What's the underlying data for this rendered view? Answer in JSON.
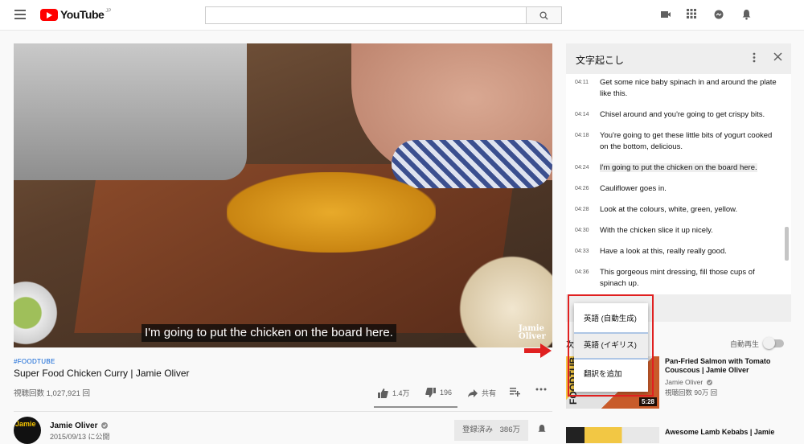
{
  "header": {
    "logo_text": "YouTube",
    "logo_region": "JP",
    "search_placeholder": "",
    "icons": [
      "menu-icon",
      "search-icon",
      "video-camera-icon",
      "apps-grid-icon",
      "chat-icon",
      "bell-icon"
    ]
  },
  "player": {
    "subtitle": "I'm going to put the chicken on the board here.",
    "watermark": "Jamie Oliver"
  },
  "video": {
    "hashtag": "#FOODTUBE",
    "title": "Super Food Chicken Curry | Jamie Oliver",
    "views": "視聴回数 1,027,921 回",
    "likes": "1.4万",
    "dislikes": "196",
    "share_label": "共有",
    "channel": "Jamie Oliver",
    "date": "2015/09/13 に公開",
    "subscribe_label": "登録済み",
    "subscriber_count": "386万"
  },
  "transcript": {
    "title": "文字起こし",
    "rows": [
      {
        "time": "04:11",
        "text": "Get some nice baby spinach in and around the plate like this."
      },
      {
        "time": "04:14",
        "text": "Chisel around and you're going to get crispy bits."
      },
      {
        "time": "04:18",
        "text": "You're going to get these little bits of yogurt cooked on the bottom, delicious."
      },
      {
        "time": "04:24",
        "text": "I'm going to put the chicken on the board here.",
        "active": true
      },
      {
        "time": "04:26",
        "text": "Cauliflower goes in."
      },
      {
        "time": "04:28",
        "text": "Look at the colours, white, green, yellow."
      },
      {
        "time": "04:30",
        "text": "With the chicken slice it up nicely."
      },
      {
        "time": "04:33",
        "text": "Have a look at this, really really good."
      },
      {
        "time": "04:36",
        "text": "This gorgeous mint dressing, fill those cups of spinach up."
      }
    ]
  },
  "language_menu": {
    "items": [
      "英語 (自動生成)",
      "英語 (イギリス)",
      "翻訳を追加"
    ],
    "selected_index": 1
  },
  "sidebar": {
    "next_label": "次",
    "autoplay_label": "自動再生",
    "autoplay_on": false,
    "recommendations": [
      {
        "title": "Pan-Fried Salmon with Tomato Couscous | Jamie Oliver",
        "channel": "Jamie Oliver",
        "views": "視聴回数 90万 回",
        "duration": "5:28",
        "thumb_text": "FOODTUBE"
      },
      {
        "title": "Awesome Lamb Kebabs | Jamie"
      }
    ]
  },
  "colors": {
    "youtube_red": "#ff0000",
    "highlight_red": "#e02020",
    "link_blue": "#065fd4"
  }
}
